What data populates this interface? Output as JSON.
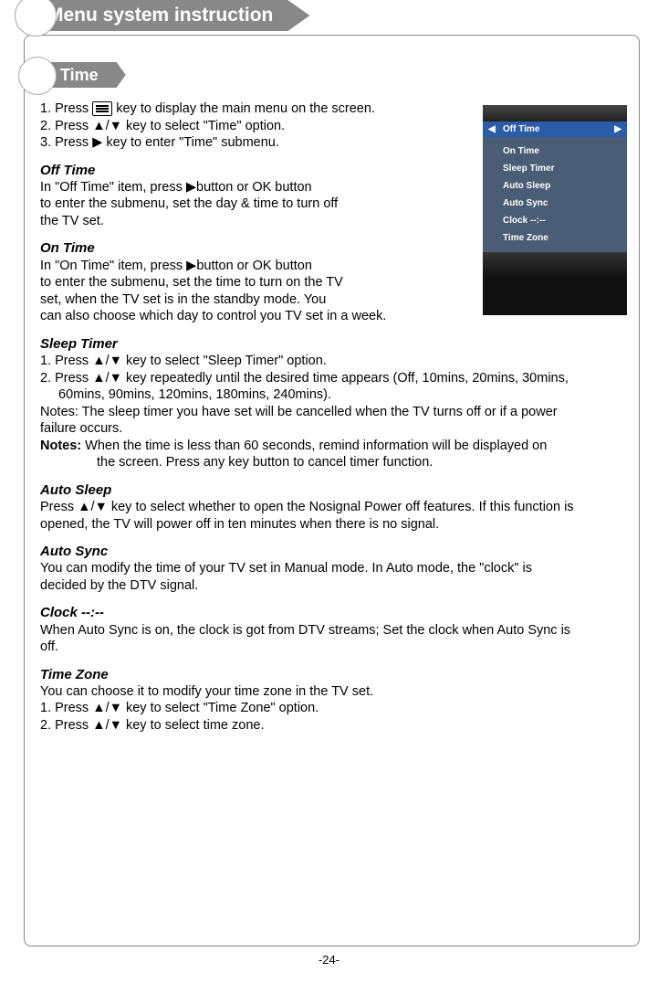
{
  "header": {
    "main_tab": "Menu system instruction",
    "sub_tab": "Time"
  },
  "intro": {
    "step1a": "1. Press ",
    "step1b": " key to display the main menu on the screen.",
    "step2": "2. Press ▲/▼ key to select \"Time\" option.",
    "step3": "3. Press ▶ key to enter \"Time\" submenu."
  },
  "sections": {
    "off_time": {
      "title": " Off Time",
      "l1": "In \"Off Time\" item, press ▶button or OK  button",
      "l2": "to enter the submenu, set the day & time to turn off",
      "l3": "the TV set."
    },
    "on_time": {
      "title": "On Time",
      "l1": "In \"On Time\" item, press ▶button or OK button",
      "l2": "to enter the submenu, set the time to turn on the TV",
      "l3": "set, when the TV set is in the standby mode. You",
      "l4": "can also choose which day to control you TV set in a week."
    },
    "sleep_timer": {
      "title": "Sleep Timer",
      "l1": "1. Press ▲/▼ key to select \"Sleep Timer\" option.",
      "l2": "2. Press ▲/▼ key repeatedly until the desired time appears (Off, 10mins, 20mins, 30mins,",
      "l2b": "60mins, 90mins, 120mins, 180mins, 240mins).",
      "l3": "Notes: The sleep timer you have set will be cancelled when the TV turns off or if a power",
      "l3b": "failure occurs.",
      "notes_label": "Notes:",
      "l4": " When the time is less than 60 seconds, remind information will be displayed on",
      "l4b": "the screen. Press any key button to cancel timer function."
    },
    "auto_sleep": {
      "title": "Auto Sleep",
      "l1": "Press ▲/▼ key to select whether to open the Nosignal Power off features. If this function is",
      "l2": "opened, the TV will power off  in ten minutes when there is no signal."
    },
    "auto_sync": {
      "title": "Auto Sync",
      "l1": "You can modify the time of your TV set in Manual mode. In Auto mode, the \"clock\" is",
      "l2": "decided by the DTV signal."
    },
    "clock": {
      "title": "Clock --:--",
      "l1": "When Auto Sync is on, the clock is got from DTV streams; Set the clock when Auto Sync is",
      "l2": "off."
    },
    "time_zone": {
      "title": "Time Zone",
      "l1": "You can choose it to modify your time zone in the TV set.",
      "l2": "1. Press ▲/▼ key to select \"Time Zone\" option.",
      "l3": "2. Press ▲/▼ key to select time zone."
    }
  },
  "osd": {
    "selected": "Off Time",
    "items": [
      "On Time",
      "Sleep Timer",
      "Auto Sleep",
      "Auto Sync",
      "Clock --:--",
      "Time Zone"
    ]
  },
  "page_number": "-24-"
}
